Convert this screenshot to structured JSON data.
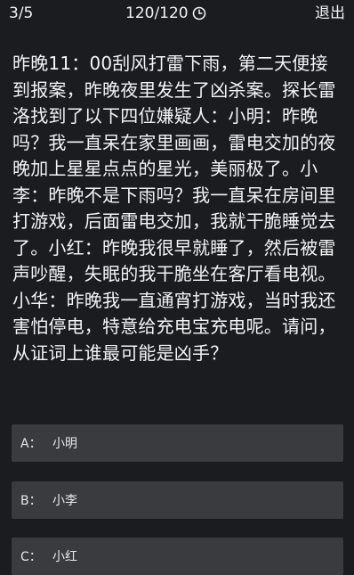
{
  "header": {
    "progress": "3/5",
    "score": "120/120",
    "timer_icon": "clock-icon",
    "exit_label": "退出"
  },
  "question": {
    "text": "昨晚11：00刮风打雷下雨，第二天便接到报案，昨晚夜里发生了凶杀案。探长雷洛找到了以下四位嫌疑人：小明：昨晚吗？我一直呆在家里画画，雷电交加的夜晚加上星星点点的星光，美丽极了。小李：昨晚不是下雨吗？我一直呆在房间里打游戏，后面雷电交加，我就干脆睡觉去了。小红：昨晚我很早就睡了，然后被雷声吵醒，失眠的我干脆坐在客厅看电视。小华：昨晚我一直通宵打游戏，当时我还害怕停电，特意给充电宝充电呢。请问，从证词上谁最可能是凶手？"
  },
  "options": [
    {
      "letter": "A：",
      "text": "小明"
    },
    {
      "letter": "B：",
      "text": "小李"
    },
    {
      "letter": "C：",
      "text": "小红"
    }
  ],
  "colors": {
    "background": "#1b1c20",
    "option_bg": "#3a3b3f",
    "text": "#f2f2f2"
  }
}
